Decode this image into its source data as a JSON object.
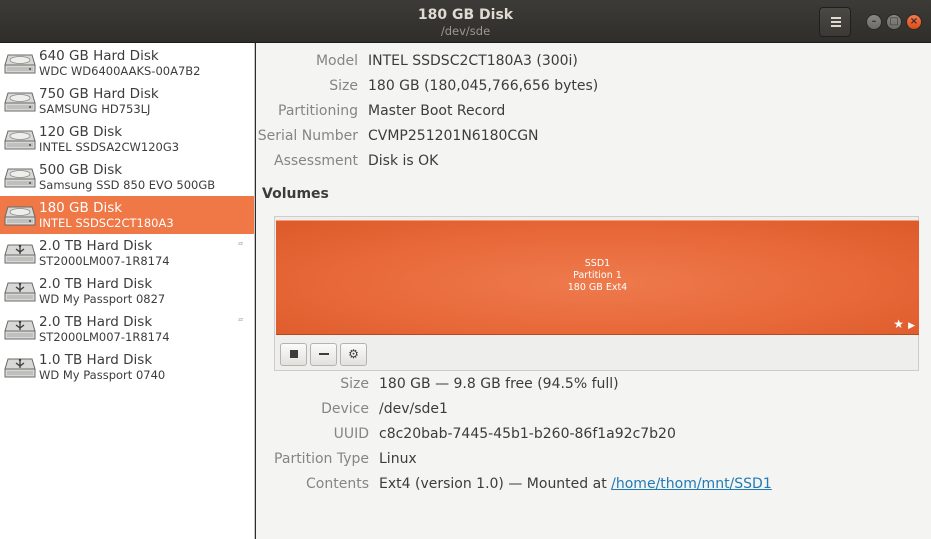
{
  "window": {
    "title": "180 GB Disk",
    "subtitle": "/dev/sde"
  },
  "colors": {
    "accent": "#f07746",
    "partition": "#e8693a",
    "link": "#1f7bb5"
  },
  "disks": [
    {
      "name": "640 GB Hard Disk",
      "model": "WDC WD6400AAKS-00A7B2",
      "icon": "hard-disk-icon",
      "selected": false,
      "sleeping": false
    },
    {
      "name": "750 GB Hard Disk",
      "model": "SAMSUNG HD753LJ",
      "icon": "hard-disk-icon",
      "selected": false,
      "sleeping": false
    },
    {
      "name": "120 GB Disk",
      "model": "INTEL SSDSA2CW120G3",
      "icon": "hard-disk-icon",
      "selected": false,
      "sleeping": false
    },
    {
      "name": "500 GB Disk",
      "model": "Samsung SSD 850 EVO 500GB",
      "icon": "hard-disk-icon",
      "selected": false,
      "sleeping": false
    },
    {
      "name": "180 GB Disk",
      "model": "INTEL SSDSC2CT180A3",
      "icon": "hard-disk-icon",
      "selected": true,
      "sleeping": false
    },
    {
      "name": "2.0 TB Hard Disk",
      "model": "ST2000LM007-1R8174",
      "icon": "usb-disk-icon",
      "selected": false,
      "sleeping": true
    },
    {
      "name": "2.0 TB Hard Disk",
      "model": "WD My Passport 0827",
      "icon": "usb-disk-icon",
      "selected": false,
      "sleeping": false
    },
    {
      "name": "2.0 TB Hard Disk",
      "model": "ST2000LM007-1R8174",
      "icon": "usb-disk-icon",
      "selected": false,
      "sleeping": true
    },
    {
      "name": "1.0 TB Hard Disk",
      "model": "WD My Passport 0740",
      "icon": "usb-disk-icon",
      "selected": false,
      "sleeping": false
    }
  ],
  "sleep_glyph": "ᶻᶻ",
  "drive": {
    "model_label": "Model",
    "model_value": "INTEL SSDSC2CT180A3 (300i)",
    "size_label": "Size",
    "size_value": "180 GB (180,045,766,656 bytes)",
    "partitioning_label": "Partitioning",
    "partitioning_value": "Master Boot Record",
    "serial_label": "Serial Number",
    "serial_value": "CVMP251201N6180CGN",
    "assessment_label": "Assessment",
    "assessment_value": "Disk is OK"
  },
  "volumes": {
    "title": "Volumes",
    "partition": {
      "line1": "SSD1",
      "line2": "Partition 1",
      "line3": "180 GB Ext4",
      "mounted_icon": "star-icon",
      "next_icon": "play-icon"
    },
    "toolbar": {
      "stop_icon": "stop-icon",
      "delete_icon": "minus-icon",
      "options_icon": "gears-icon"
    }
  },
  "volume_details": {
    "size_label": "Size",
    "size_value": "180 GB — 9.8 GB free (94.5% full)",
    "device_label": "Device",
    "device_value": "/dev/sde1",
    "uuid_label": "UUID",
    "uuid_value": "c8c20bab-7445-45b1-b260-86f1a92c7b20",
    "type_label": "Partition Type",
    "type_value": "Linux",
    "contents_label": "Contents",
    "contents_prefix": "Ext4 (version 1.0) — Mounted at ",
    "contents_link": "/home/thom/mnt/SSD1"
  }
}
